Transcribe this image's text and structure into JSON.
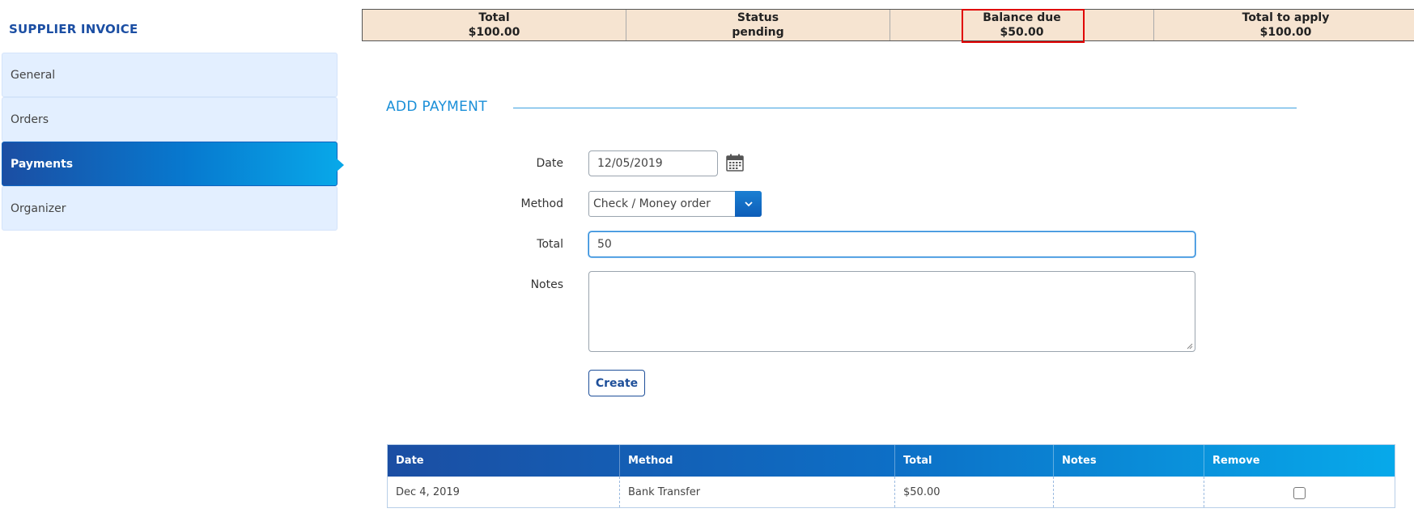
{
  "app": {
    "title": "SUPPLIER INVOICE"
  },
  "sidebar": {
    "items": [
      {
        "label": "General",
        "active": false
      },
      {
        "label": "Orders",
        "active": false
      },
      {
        "label": "Payments",
        "active": true
      },
      {
        "label": "Organizer",
        "active": false
      }
    ]
  },
  "summary": {
    "cells": [
      {
        "label": "Total",
        "value": "$100.00"
      },
      {
        "label": "Status",
        "value": "pending"
      },
      {
        "label": "Balance due",
        "value": "$50.00"
      },
      {
        "label": "Total to apply",
        "value": "$100.00"
      }
    ],
    "highlight_color": "#e00000"
  },
  "add_payment": {
    "title": "ADD PAYMENT",
    "date_label": "Date",
    "date_value": "12/05/2019",
    "method_label": "Method",
    "method_value": "Check / Money order",
    "total_label": "Total",
    "total_value": "50",
    "notes_label": "Notes",
    "notes_value": "",
    "create_label": "Create",
    "icons": {
      "calendar": "calendar-icon",
      "dropdown": "chevron-down-icon"
    }
  },
  "payments_table": {
    "headers": [
      "Date",
      "Method",
      "Total",
      "Notes",
      "Remove"
    ],
    "rows": [
      {
        "date": "Dec 4, 2019",
        "method": "Bank Transfer",
        "total": "$50.00",
        "notes": "",
        "remove": false
      }
    ]
  },
  "colors": {
    "brand_blue": "#1b4ea3",
    "accent_blue": "#1a8fd8",
    "summary_bg": "#f6e4d1",
    "sidebar_bg": "#e3efff"
  }
}
